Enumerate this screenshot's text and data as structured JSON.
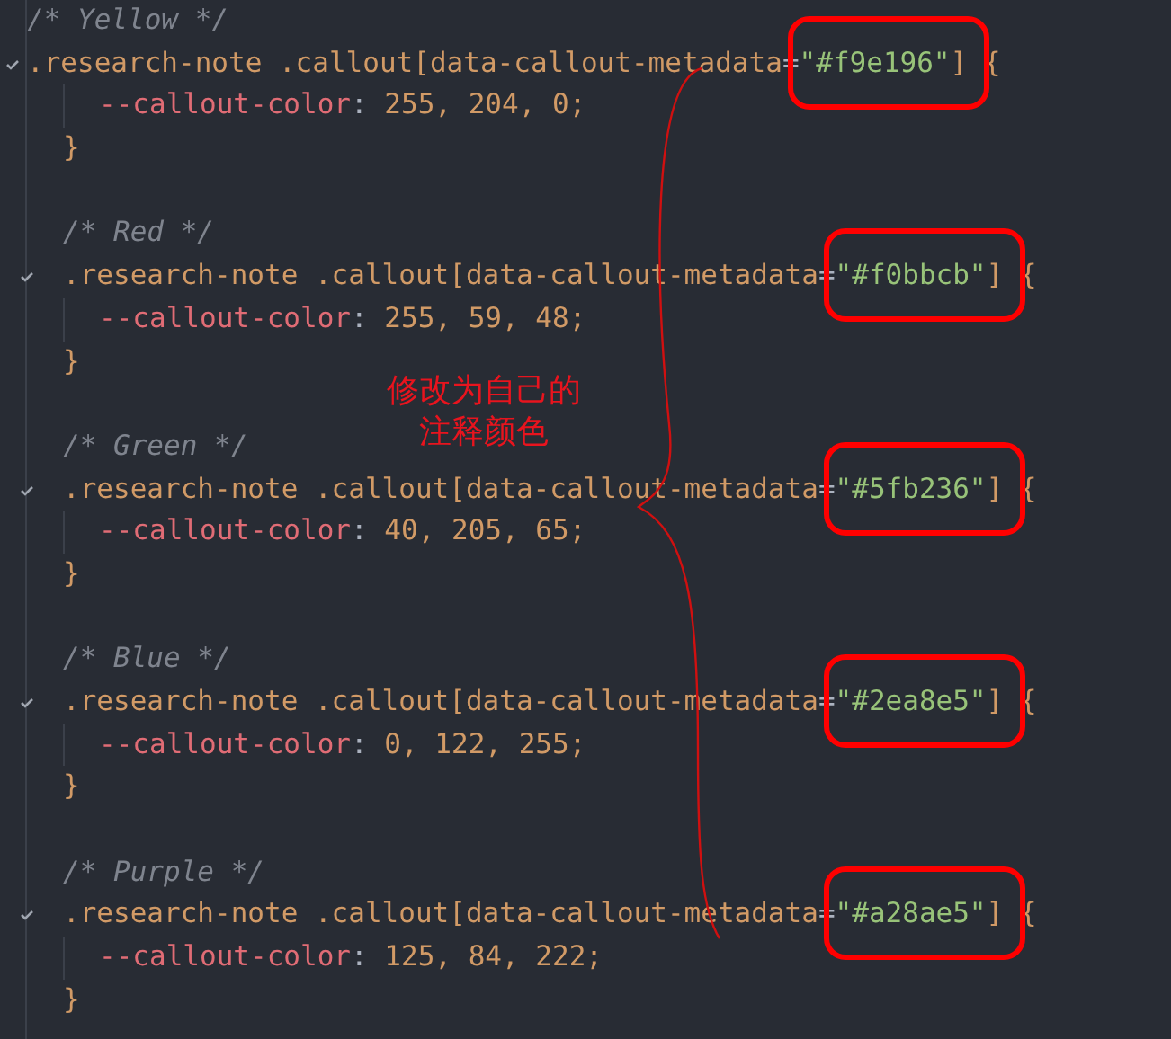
{
  "code_blocks": [
    {
      "comment": "/* Yellow */",
      "indented": false,
      "selector": ".research-note .callout[data-callout-metadata",
      "equals": "=",
      "value": "\"#f9e196\"",
      "selector_end": "] {",
      "property": "--callout-color",
      "colon": ":",
      "property_value": "255, 204, 0;",
      "close": "}",
      "highlighted": true
    },
    {
      "comment": "/* Red */",
      "indented": true,
      "selector": ".research-note .callout[data-callout-metadata",
      "equals": "=",
      "value": "\"#f0bbcb\"",
      "selector_end": "] {",
      "property": "--callout-color",
      "colon": ":",
      "property_value": "255, 59, 48;",
      "close": "}",
      "highlighted": true
    },
    {
      "comment": "/* Green */",
      "indented": true,
      "selector": ".research-note .callout[data-callout-metadata",
      "equals": "=",
      "value": "\"#5fb236\"",
      "selector_end": "] {",
      "property": "--callout-color",
      "colon": ":",
      "property_value": "40, 205, 65;",
      "close": "}",
      "highlighted": true
    },
    {
      "comment": "/* Blue */",
      "indented": true,
      "selector": ".research-note .callout[data-callout-metadata",
      "equals": "=",
      "value": "\"#2ea8e5\"",
      "selector_end": "] {",
      "property": "--callout-color",
      "colon": ":",
      "property_value": "0, 122, 255;",
      "close": "}",
      "highlighted": true
    },
    {
      "comment": "/* Purple */",
      "indented": true,
      "selector": ".research-note .callout[data-callout-metadata",
      "equals": "=",
      "value": "\"#a28ae5\"",
      "selector_end": "] {",
      "property": "--callout-color",
      "colon": ":",
      "property_value": "125, 84, 222;",
      "close": "}",
      "highlighted": true
    }
  ],
  "annotation": {
    "lines": [
      "修改为自己的",
      "注释颜色"
    ]
  }
}
